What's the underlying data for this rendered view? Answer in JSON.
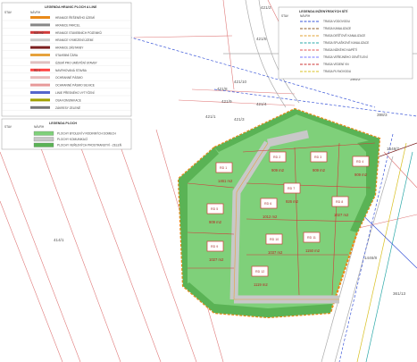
{
  "legend_boundary": {
    "title": "LEGENDA HRANIC PLOCH A LINIÍ",
    "col_stav": "STAV",
    "col_navrh": "NÁVRH",
    "items": [
      {
        "text": "HRANICE ŘEŠENÉHO ÚZEMÍ",
        "color": "#e98a1a"
      },
      {
        "text": "HRANICE PARCEL",
        "color": "#888888"
      },
      {
        "text": "HRANICE STAVEBNÍCH POZEMKŮ",
        "color": "#d23a3a",
        "value": "523 m2"
      },
      {
        "text": "HRANICE VYMEZENÍ ÚZEMÍ",
        "color": "#c9c9c9"
      },
      {
        "text": "HRANICE ZÁSTAVBY",
        "color": "#7b1f1f"
      },
      {
        "text": "STAVEBNÍ ČÁRA",
        "color": "#e6a23c"
      },
      {
        "text": "ÚZEMÍ PRO UMÍSTĚNÍ STAVBY",
        "color": "#e0c0c0"
      },
      {
        "text": "NAVRHOVANÁ STAVBA",
        "color": "#ff4444",
        "value": "RD 1"
      },
      {
        "text": "OCHRANNÉ PÁSMO",
        "color": "#e7b9b9"
      },
      {
        "text": "OCHRANNÉ PÁSMO SILNICE",
        "color": "#e79a9a"
      },
      {
        "text": "LINIE PŘESNÉHO VYTYČENÍ",
        "color": "#5566cc"
      },
      {
        "text": "OSA KOMUNIKACE",
        "color": "#a0a000"
      },
      {
        "text": "ZÁKRESY ZELENĚ",
        "color": "#777777"
      }
    ]
  },
  "legend_areas": {
    "title": "LEGENDA PLOCH",
    "col_stav": "STAV",
    "col_navrh": "NÁVRH",
    "items": [
      {
        "text": "PLOCHY BYDLENÍ V RODINNÝCH DOMECH",
        "color": "#7fd07a"
      },
      {
        "text": "PLOCHY KOMUNIKACÍ",
        "color": "#c8c8c8"
      },
      {
        "text": "PLOCHY VEŘEJNÝCH PROSTRANSTVÍ - ZELEŇ",
        "color": "#5ab355"
      }
    ]
  },
  "legend_networks": {
    "title": "LEGENDA INŽENÝRSKÝCH SÍTÍ",
    "col_stav": "STAV",
    "col_navrh": "NÁVRH",
    "items": [
      {
        "text": "TRASA VODOVODU",
        "color": "#3a56d8"
      },
      {
        "text": "TRASA KANALIZACE",
        "color": "#8b5a2b"
      },
      {
        "text": "TRASA DEŠŤOVÉ KANALIZACE",
        "color": "#e0a030"
      },
      {
        "text": "TRASA SPLAŠKOVÉ KANALIZACE",
        "color": "#2aa8a8"
      },
      {
        "text": "TRASA NÍZKÉHO NAPĚTÍ",
        "color": "#e25555"
      },
      {
        "text": "TRASA VEŘEJNÉHO OSVĚTLENÍ",
        "color": "#7777ff"
      },
      {
        "text": "TRASA VEDENÍ VN",
        "color": "#cc3333"
      },
      {
        "text": "TRASA PLYNOVODU",
        "color": "#d8c020"
      }
    ]
  },
  "parcels": [
    "421/2",
    "421/5",
    "421/10",
    "421/8",
    "421/9",
    "421/4",
    "421/3",
    "421/1",
    "414/1",
    "398/2",
    "398/3",
    "1548/7",
    "1446/8",
    "361/13"
  ],
  "lots": [
    {
      "id": "RD 1",
      "area": "1461 m2"
    },
    {
      "id": "RD 2",
      "area": "909 m2"
    },
    {
      "id": "RD 3",
      "area": "909 m2"
    },
    {
      "id": "RD 4",
      "area": "909 m2"
    },
    {
      "id": "RD 5",
      "area": "909 m2"
    },
    {
      "id": "RD 6",
      "area": "1012 m2"
    },
    {
      "id": "RD 7",
      "area": "926 m2"
    },
    {
      "id": "RD 8",
      "area": "1027 m2"
    },
    {
      "id": "RD 9",
      "area": "1027 m2"
    },
    {
      "id": "RD 10",
      "area": "1037 m2"
    },
    {
      "id": "RD 11",
      "area": "1150 m2"
    },
    {
      "id": "RD 12",
      "area": "1119 m2"
    }
  ]
}
